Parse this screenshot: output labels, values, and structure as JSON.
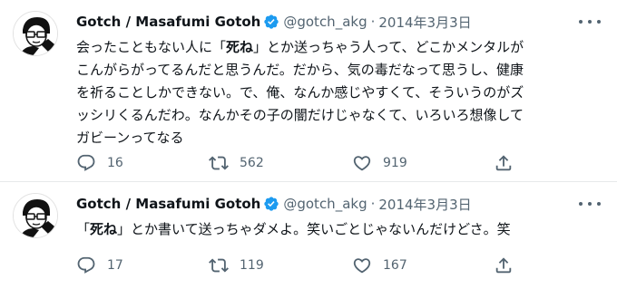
{
  "tweets": [
    {
      "author_name": "Gotch / Masafumi Gotoh",
      "handle": "@gotch_akg",
      "separator": "·",
      "date": "2014年3月3日",
      "lines": [
        {
          "pre": "会ったこともない人に「",
          "bold": "死ね",
          "post": "」とか送っちゃう人って、どこかメンタルが"
        },
        {
          "pre": "こんがらがってるんだと思うんだ。だから、気の毒だなって思うし、健康",
          "bold": "",
          "post": ""
        },
        {
          "pre": "を祈ることしかできない。で、俺、なんか感じやすくて、そういうのがズ",
          "bold": "",
          "post": ""
        },
        {
          "pre": "ッシリくるんだわ。なんかその子の闇だけじゃなくて、いろいろ想像して",
          "bold": "",
          "post": ""
        },
        {
          "pre": "ガビーンってなる",
          "bold": "",
          "post": ""
        }
      ],
      "replies": "16",
      "retweets": "562",
      "likes": "919"
    },
    {
      "author_name": "Gotch / Masafumi Gotoh",
      "handle": "@gotch_akg",
      "separator": "·",
      "date": "2014年3月3日",
      "lines": [
        {
          "pre": "「",
          "bold": "死ね",
          "post": "」とか書いて送っちゃダメよ。笑いごとじゃないんだけどさ。笑"
        }
      ],
      "replies": "17",
      "retweets": "119",
      "likes": "167"
    }
  ],
  "icons": {
    "avatar": "cartoon-avatar-icon",
    "verified": "verified-badge-icon",
    "more": "more-options-icon",
    "reply": "reply-icon",
    "retweet": "retweet-icon",
    "like": "heart-icon",
    "share": "share-icon"
  },
  "colors": {
    "verified_blue": "#1d9bf0",
    "secondary_text": "#536471",
    "primary_text": "#0f1419",
    "divider": "#e7e9ea"
  }
}
